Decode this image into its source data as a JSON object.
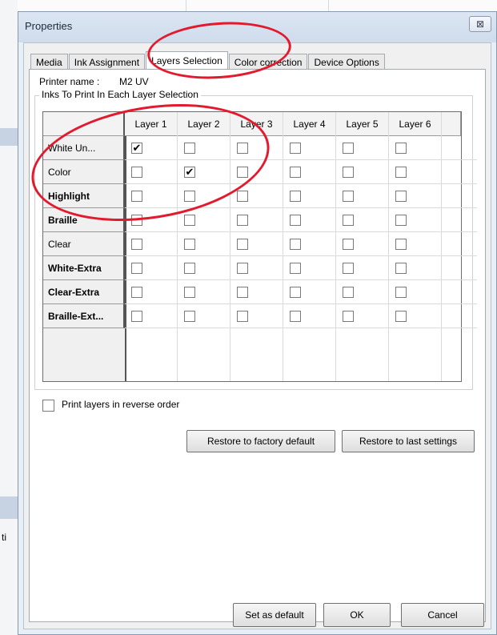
{
  "window": {
    "title": "Properties",
    "close_glyph": "⊠"
  },
  "tabs": [
    {
      "label": "Media",
      "active": false
    },
    {
      "label": "Ink Assignment",
      "active": false
    },
    {
      "label": "Layers Selection",
      "active": true
    },
    {
      "label": "Color correction",
      "active": false
    },
    {
      "label": "Device Options",
      "active": false
    }
  ],
  "printer": {
    "label": "Printer name :",
    "value": "M2 UV"
  },
  "group": {
    "title": "Inks To Print In Each Layer Selection"
  },
  "grid": {
    "columns": [
      "Layer 1",
      "Layer 2",
      "Layer 3",
      "Layer 4",
      "Layer 5",
      "Layer 6"
    ],
    "rows": [
      {
        "label": "White Un...",
        "checked": [
          true,
          false,
          false,
          false,
          false,
          false
        ]
      },
      {
        "label": "Color",
        "checked": [
          false,
          true,
          false,
          false,
          false,
          false
        ]
      },
      {
        "label": "Highlight",
        "checked": [
          false,
          false,
          false,
          false,
          false,
          false
        ]
      },
      {
        "label": "Braille",
        "checked": [
          false,
          false,
          false,
          false,
          false,
          false
        ]
      },
      {
        "label": "Clear",
        "checked": [
          false,
          false,
          false,
          false,
          false,
          false
        ]
      },
      {
        "label": "White-Extra",
        "checked": [
          false,
          false,
          false,
          false,
          false,
          false
        ]
      },
      {
        "label": "Clear-Extra",
        "checked": [
          false,
          false,
          false,
          false,
          false,
          false
        ]
      },
      {
        "label": "Braille-Ext...",
        "checked": [
          false,
          false,
          false,
          false,
          false,
          false
        ]
      }
    ],
    "check_glyph": "✔"
  },
  "options": {
    "reverse_label": "Print layers in reverse order",
    "reverse_checked": false
  },
  "buttons": {
    "restore_factory": "Restore to factory default",
    "restore_last": "Restore to last settings",
    "set_default": "Set as default",
    "ok": "OK",
    "cancel": "Cancel"
  },
  "colors": {
    "annotation": "#e3192e",
    "dialog_bg": "#e8eef6",
    "tab_active": "#ffffff"
  },
  "background_app": {
    "left_text": "ti"
  }
}
